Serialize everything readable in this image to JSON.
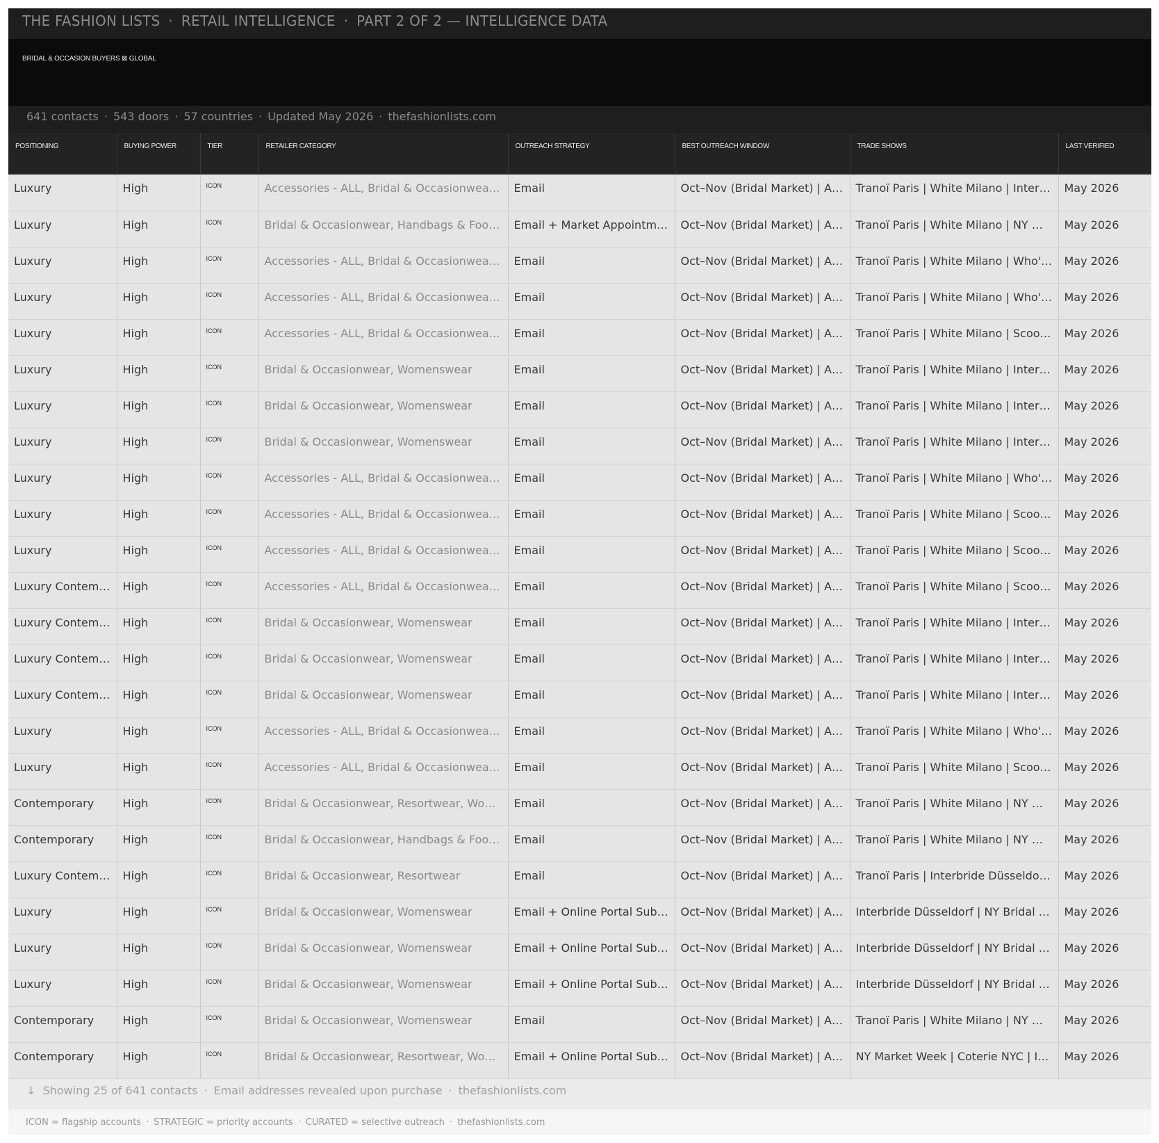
{
  "header": {
    "brand": "THE FASHION LISTS",
    "section": "RETAIL INTELLIGENCE",
    "part": "PART 2 OF 2 — INTELLIGENCE DATA",
    "separator": "·"
  },
  "hero": {
    "subtitle": "BRIDAL & OCCASION BUYERS ⊠ GLOBAL"
  },
  "stats": {
    "contacts": "641 contacts",
    "doors": "543 doors",
    "countries": "57 countries",
    "updated": "Updated May 2026",
    "site": "thefashionlists.com"
  },
  "table": {
    "columns": [
      "POSITIONING",
      "BUYING POWER",
      "TIER",
      "RETAILER CATEGORY",
      "OUTREACH STRATEGY",
      "BEST OUTREACH WINDOW",
      "TRADE SHOWS",
      "LAST VERIFIED"
    ],
    "rows": [
      [
        "Luxury",
        "High",
        "ICON",
        "Accessories - ALL, Bridal & Occasionwear…",
        "Email",
        "Oct–Nov (Bridal Market) | A…",
        "Tranoï Paris | White Milano | Inter…",
        "May 2026"
      ],
      [
        "Luxury",
        "High",
        "ICON",
        "Bridal & Occasionwear, Handbags & Foot…",
        "Email + Market Appointm…",
        "Oct–Nov (Bridal Market) | A…",
        "Tranoï Paris | White Milano | NY M…",
        "May 2026"
      ],
      [
        "Luxury",
        "High",
        "ICON",
        "Accessories - ALL, Bridal & Occasionwear…",
        "Email",
        "Oct–Nov (Bridal Market) | A…",
        "Tranoï Paris | White Milano | Who'…",
        "May 2026"
      ],
      [
        "Luxury",
        "High",
        "ICON",
        "Accessories - ALL, Bridal & Occasionwear…",
        "Email",
        "Oct–Nov (Bridal Market) | A…",
        "Tranoï Paris | White Milano | Who'…",
        "May 2026"
      ],
      [
        "Luxury",
        "High",
        "ICON",
        "Accessories - ALL, Bridal & Occasionwear…",
        "Email",
        "Oct–Nov (Bridal Market) | A…",
        "Tranoï Paris | White Milano | Scoo…",
        "May 2026"
      ],
      [
        "Luxury",
        "High",
        "ICON",
        "Bridal & Occasionwear, Womenswear",
        "Email",
        "Oct–Nov (Bridal Market) | A…",
        "Tranoï Paris | White Milano | Inter…",
        "May 2026"
      ],
      [
        "Luxury",
        "High",
        "ICON",
        "Bridal & Occasionwear, Womenswear",
        "Email",
        "Oct–Nov (Bridal Market) | A…",
        "Tranoï Paris | White Milano | Inter…",
        "May 2026"
      ],
      [
        "Luxury",
        "High",
        "ICON",
        "Bridal & Occasionwear, Womenswear",
        "Email",
        "Oct–Nov (Bridal Market) | A…",
        "Tranoï Paris | White Milano | Inter…",
        "May 2026"
      ],
      [
        "Luxury",
        "High",
        "ICON",
        "Accessories - ALL, Bridal & Occasionwear…",
        "Email",
        "Oct–Nov (Bridal Market) | A…",
        "Tranoï Paris | White Milano | Who'…",
        "May 2026"
      ],
      [
        "Luxury",
        "High",
        "ICON",
        "Accessories - ALL, Bridal & Occasionwear…",
        "Email",
        "Oct–Nov (Bridal Market) | A…",
        "Tranoï Paris | White Milano | Scoo…",
        "May 2026"
      ],
      [
        "Luxury",
        "High",
        "ICON",
        "Accessories - ALL, Bridal & Occasionwear…",
        "Email",
        "Oct–Nov (Bridal Market) | A…",
        "Tranoï Paris | White Milano | Scoo…",
        "May 2026"
      ],
      [
        "Luxury Contem…",
        "High",
        "ICON",
        "Accessories - ALL, Bridal & Occasionwear…",
        "Email",
        "Oct–Nov (Bridal Market) | A…",
        "Tranoï Paris | White Milano | Scoo…",
        "May 2026"
      ],
      [
        "Luxury Contem…",
        "High",
        "ICON",
        "Bridal & Occasionwear, Womenswear",
        "Email",
        "Oct–Nov (Bridal Market) | A…",
        "Tranoï Paris | White Milano | Inter…",
        "May 2026"
      ],
      [
        "Luxury Contem…",
        "High",
        "ICON",
        "Bridal & Occasionwear, Womenswear",
        "Email",
        "Oct–Nov (Bridal Market) | A…",
        "Tranoï Paris | White Milano | Inter…",
        "May 2026"
      ],
      [
        "Luxury Contem…",
        "High",
        "ICON",
        "Bridal & Occasionwear, Womenswear",
        "Email",
        "Oct–Nov (Bridal Market) | A…",
        "Tranoï Paris | White Milano | Inter…",
        "May 2026"
      ],
      [
        "Luxury",
        "High",
        "ICON",
        "Accessories - ALL, Bridal & Occasionwear…",
        "Email",
        "Oct–Nov (Bridal Market) | A…",
        "Tranoï Paris | White Milano | Who'…",
        "May 2026"
      ],
      [
        "Luxury",
        "High",
        "ICON",
        "Accessories - ALL, Bridal & Occasionwear…",
        "Email",
        "Oct–Nov (Bridal Market) | A…",
        "Tranoï Paris | White Milano | Scoo…",
        "May 2026"
      ],
      [
        "Contemporary",
        "High",
        "ICON",
        "Bridal & Occasionwear, Resortwear, Wo…",
        "Email",
        "Oct–Nov (Bridal Market) | A…",
        "Tranoï Paris | White Milano | NY M…",
        "May 2026"
      ],
      [
        "Contemporary",
        "High",
        "ICON",
        "Bridal & Occasionwear, Handbags & Foot…",
        "Email",
        "Oct–Nov (Bridal Market) | A…",
        "Tranoï Paris | White Milano | NY M…",
        "May 2026"
      ],
      [
        "Luxury Contem…",
        "High",
        "ICON",
        "Bridal & Occasionwear, Resortwear",
        "Email",
        "Oct–Nov (Bridal Market) | A…",
        "Tranoï Paris | Interbride Düsseldo…",
        "May 2026"
      ],
      [
        "Luxury",
        "High",
        "ICON",
        "Bridal & Occasionwear, Womenswear",
        "Email + Online Portal Sub…",
        "Oct–Nov (Bridal Market) | A…",
        "Interbride Düsseldorf | NY Bridal …",
        "May 2026"
      ],
      [
        "Luxury",
        "High",
        "ICON",
        "Bridal & Occasionwear, Womenswear",
        "Email + Online Portal Sub…",
        "Oct–Nov (Bridal Market) | A…",
        "Interbride Düsseldorf | NY Bridal …",
        "May 2026"
      ],
      [
        "Luxury",
        "High",
        "ICON",
        "Bridal & Occasionwear, Womenswear",
        "Email + Online Portal Sub…",
        "Oct–Nov (Bridal Market) | A…",
        "Interbride Düsseldorf | NY Bridal …",
        "May 2026"
      ],
      [
        "Contemporary",
        "High",
        "ICON",
        "Bridal & Occasionwear, Womenswear",
        "Email",
        "Oct–Nov (Bridal Market) | A…",
        "Tranoï Paris | White Milano | NY M…",
        "May 2026"
      ],
      [
        "Contemporary",
        "High",
        "ICON",
        "Bridal & Occasionwear, Resortwear, Wo…",
        "Email + Online Portal Sub…",
        "Oct–Nov (Bridal Market) | A…",
        "NY Market Week | Coterie NYC | I…",
        "May 2026"
      ]
    ]
  },
  "footer": {
    "arrow_icon": "arrow-down-icon",
    "arrow": "↓",
    "showing": "Showing 25 of 641 contacts",
    "note": "Email addresses revealed upon purchase",
    "site": "thefashionlists.com"
  },
  "legend": {
    "icon": "ICON = flagship accounts",
    "strategic": "STRATEGIC = priority accounts",
    "curated": "CURATED = selective outreach",
    "site": "thefashionlists.com"
  }
}
